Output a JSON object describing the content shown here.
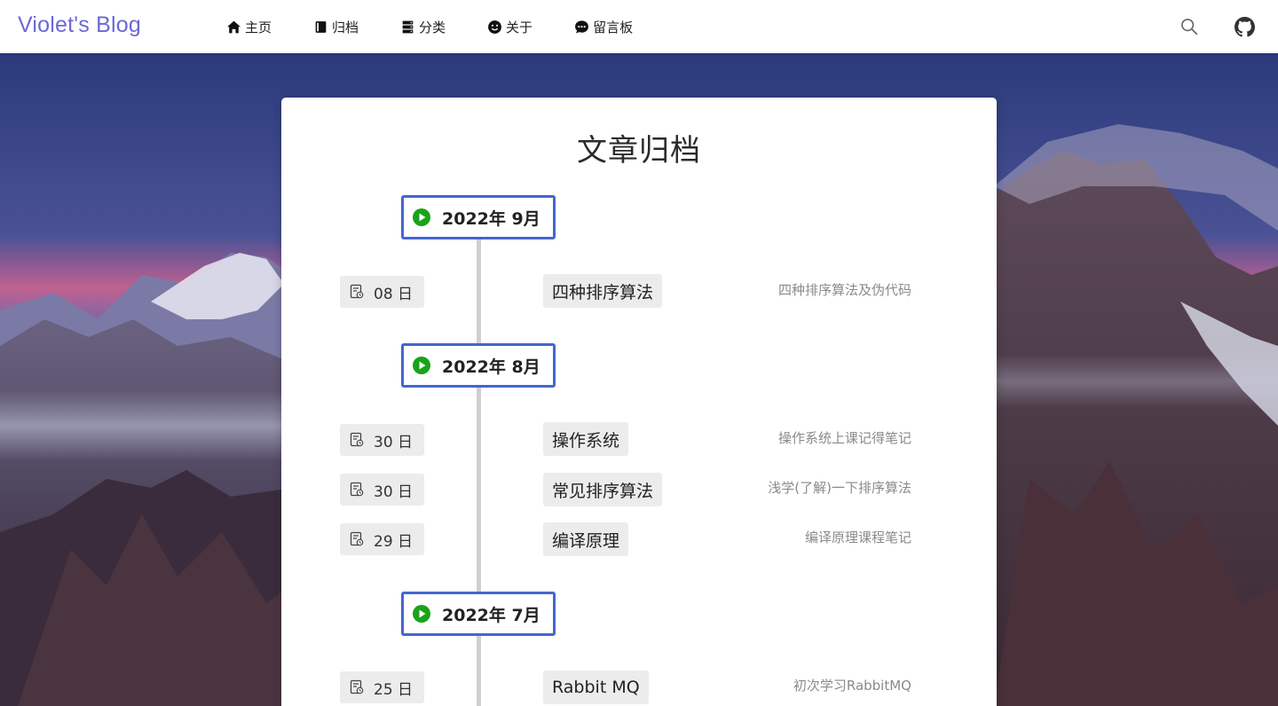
{
  "brand": "Violet's Blog",
  "nav": [
    {
      "label": "主页",
      "icon": "home-icon"
    },
    {
      "label": "归档",
      "icon": "archive-icon"
    },
    {
      "label": "分类",
      "icon": "category-icon"
    },
    {
      "label": "关于",
      "icon": "smile-icon"
    },
    {
      "label": "留言板",
      "icon": "message-icon"
    }
  ],
  "nav_right": {
    "search_icon": "search-icon",
    "github_icon": "github-icon"
  },
  "colors": {
    "brand": "#6b68d6",
    "month_border": "#4466d1",
    "play": "#1aa31a",
    "chip_bg": "#ececec"
  },
  "page_title": "文章归档",
  "archive": [
    {
      "month": "2022年 9月",
      "posts": [
        {
          "day": "08 日",
          "title": "四种排序算法",
          "desc": "四种排序算法及伪代码"
        }
      ]
    },
    {
      "month": "2022年 8月",
      "posts": [
        {
          "day": "30 日",
          "title": "操作系统",
          "desc": "操作系统上课记得笔记"
        },
        {
          "day": "30 日",
          "title": "常见排序算法",
          "desc": "浅学(了解)一下排序算法"
        },
        {
          "day": "29 日",
          "title": "编译原理",
          "desc": "编译原理课程笔记"
        }
      ]
    },
    {
      "month": "2022年 7月",
      "posts": [
        {
          "day": "25 日",
          "title": "Rabbit MQ",
          "desc": "初次学习RabbitMQ"
        }
      ]
    }
  ]
}
